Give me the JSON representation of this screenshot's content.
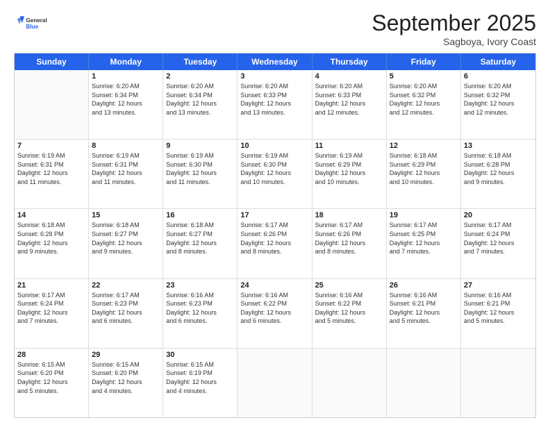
{
  "header": {
    "logo_general": "General",
    "logo_blue": "Blue",
    "month_title": "September 2025",
    "subtitle": "Sagboya, Ivory Coast"
  },
  "days_of_week": [
    "Sunday",
    "Monday",
    "Tuesday",
    "Wednesday",
    "Thursday",
    "Friday",
    "Saturday"
  ],
  "weeks": [
    [
      {
        "day": "",
        "empty": true
      },
      {
        "day": "1",
        "sunrise": "6:20 AM",
        "sunset": "6:34 PM",
        "daylight": "12 hours and 13 minutes."
      },
      {
        "day": "2",
        "sunrise": "6:20 AM",
        "sunset": "6:34 PM",
        "daylight": "12 hours and 13 minutes."
      },
      {
        "day": "3",
        "sunrise": "6:20 AM",
        "sunset": "6:33 PM",
        "daylight": "12 hours and 13 minutes."
      },
      {
        "day": "4",
        "sunrise": "6:20 AM",
        "sunset": "6:33 PM",
        "daylight": "12 hours and 12 minutes."
      },
      {
        "day": "5",
        "sunrise": "6:20 AM",
        "sunset": "6:32 PM",
        "daylight": "12 hours and 12 minutes."
      },
      {
        "day": "6",
        "sunrise": "6:20 AM",
        "sunset": "6:32 PM",
        "daylight": "12 hours and 12 minutes."
      }
    ],
    [
      {
        "day": "7",
        "sunrise": "6:19 AM",
        "sunset": "6:31 PM",
        "daylight": "12 hours and 11 minutes."
      },
      {
        "day": "8",
        "sunrise": "6:19 AM",
        "sunset": "6:31 PM",
        "daylight": "12 hours and 11 minutes."
      },
      {
        "day": "9",
        "sunrise": "6:19 AM",
        "sunset": "6:30 PM",
        "daylight": "12 hours and 11 minutes."
      },
      {
        "day": "10",
        "sunrise": "6:19 AM",
        "sunset": "6:30 PM",
        "daylight": "12 hours and 10 minutes."
      },
      {
        "day": "11",
        "sunrise": "6:19 AM",
        "sunset": "6:29 PM",
        "daylight": "12 hours and 10 minutes."
      },
      {
        "day": "12",
        "sunrise": "6:18 AM",
        "sunset": "6:29 PM",
        "daylight": "12 hours and 10 minutes."
      },
      {
        "day": "13",
        "sunrise": "6:18 AM",
        "sunset": "6:28 PM",
        "daylight": "12 hours and 9 minutes."
      }
    ],
    [
      {
        "day": "14",
        "sunrise": "6:18 AM",
        "sunset": "6:28 PM",
        "daylight": "12 hours and 9 minutes."
      },
      {
        "day": "15",
        "sunrise": "6:18 AM",
        "sunset": "6:27 PM",
        "daylight": "12 hours and 9 minutes."
      },
      {
        "day": "16",
        "sunrise": "6:18 AM",
        "sunset": "6:27 PM",
        "daylight": "12 hours and 8 minutes."
      },
      {
        "day": "17",
        "sunrise": "6:17 AM",
        "sunset": "6:26 PM",
        "daylight": "12 hours and 8 minutes."
      },
      {
        "day": "18",
        "sunrise": "6:17 AM",
        "sunset": "6:26 PM",
        "daylight": "12 hours and 8 minutes."
      },
      {
        "day": "19",
        "sunrise": "6:17 AM",
        "sunset": "6:25 PM",
        "daylight": "12 hours and 7 minutes."
      },
      {
        "day": "20",
        "sunrise": "6:17 AM",
        "sunset": "6:24 PM",
        "daylight": "12 hours and 7 minutes."
      }
    ],
    [
      {
        "day": "21",
        "sunrise": "6:17 AM",
        "sunset": "6:24 PM",
        "daylight": "12 hours and 7 minutes."
      },
      {
        "day": "22",
        "sunrise": "6:17 AM",
        "sunset": "6:23 PM",
        "daylight": "12 hours and 6 minutes."
      },
      {
        "day": "23",
        "sunrise": "6:16 AM",
        "sunset": "6:23 PM",
        "daylight": "12 hours and 6 minutes."
      },
      {
        "day": "24",
        "sunrise": "6:16 AM",
        "sunset": "6:22 PM",
        "daylight": "12 hours and 6 minutes."
      },
      {
        "day": "25",
        "sunrise": "6:16 AM",
        "sunset": "6:22 PM",
        "daylight": "12 hours and 5 minutes."
      },
      {
        "day": "26",
        "sunrise": "6:16 AM",
        "sunset": "6:21 PM",
        "daylight": "12 hours and 5 minutes."
      },
      {
        "day": "27",
        "sunrise": "6:16 AM",
        "sunset": "6:21 PM",
        "daylight": "12 hours and 5 minutes."
      }
    ],
    [
      {
        "day": "28",
        "sunrise": "6:15 AM",
        "sunset": "6:20 PM",
        "daylight": "12 hours and 5 minutes."
      },
      {
        "day": "29",
        "sunrise": "6:15 AM",
        "sunset": "6:20 PM",
        "daylight": "12 hours and 4 minutes."
      },
      {
        "day": "30",
        "sunrise": "6:15 AM",
        "sunset": "6:19 PM",
        "daylight": "12 hours and 4 minutes."
      },
      {
        "day": "",
        "empty": true
      },
      {
        "day": "",
        "empty": true
      },
      {
        "day": "",
        "empty": true
      },
      {
        "day": "",
        "empty": true
      }
    ]
  ]
}
